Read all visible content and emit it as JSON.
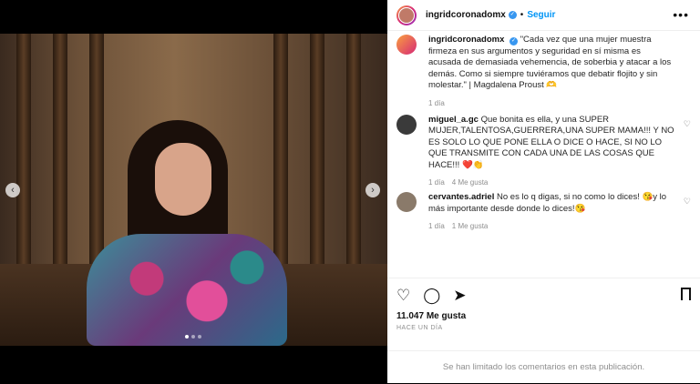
{
  "post": {
    "username": "ingridcoronadomx",
    "separator": "•",
    "follow_label": "Seguir",
    "more_icon": "more-options-icon",
    "caption": "\"Cada vez que una mujer muestra firmeza en sus argumentos y seguridad en sí misma es acusada de demasiada vehemencia, de soberbia y atacar a los demás. Como si siempre tuviéramos que debatir flojito y sin molestar.\" | Magdalena Proust 🫶",
    "caption_time": "1 día"
  },
  "comments": [
    {
      "username": "miguel_a.gc",
      "text": "Que bonita es ella, y una SUPER MUJER,TALENTOSA,GUERRERA,UNA SUPER MAMA!!! Y NO ES SOLO LO QUE PONE ELLA O DICE O HACE, SI NO LO QUE TRANSMITE CON CADA UNA DE LAS COSAS QUE HACE!!! ❤️👏",
      "time": "1 día",
      "likes": "4 Me gusta"
    },
    {
      "username": "cervantes.adriel",
      "text": "No es lo q digas, si no como lo dices! 😘y lo más importante desde donde lo dices!😘",
      "time": "1 día",
      "likes": "1 Me gusta"
    }
  ],
  "actions": {
    "like_icon": "heart-icon",
    "comment_icon": "comment-icon",
    "share_icon": "share-icon",
    "save_icon": "bookmark-icon",
    "likes_count": "11.047 Me gusta",
    "posted_ago": "HACE UN DÍA",
    "comments_limited": "Se han limitado los comentarios en esta publicación."
  }
}
